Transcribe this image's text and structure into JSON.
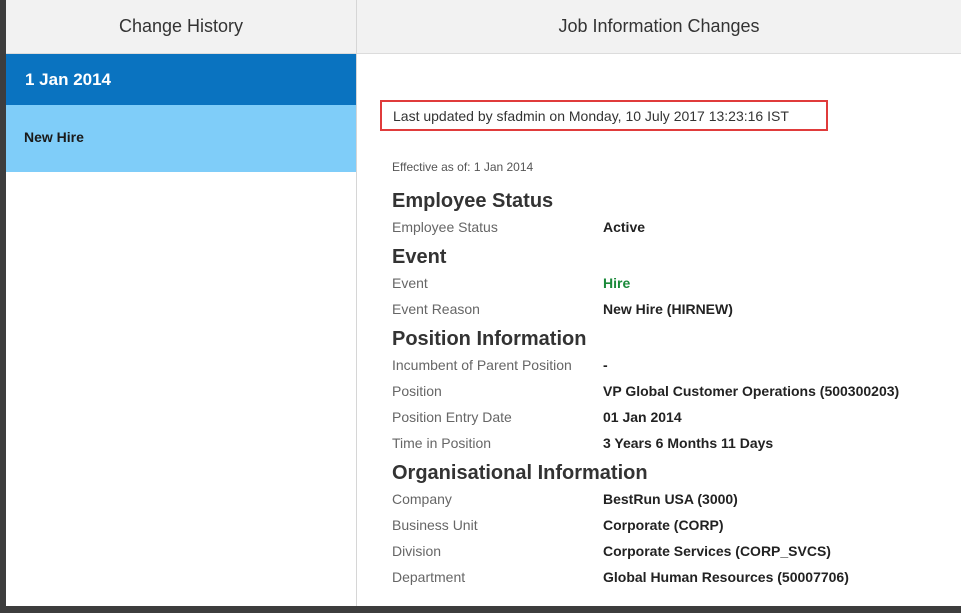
{
  "left_panel": {
    "header": "Change History",
    "date": "1 Jan 2014",
    "item": "New Hire"
  },
  "right_panel": {
    "header": "Job Information Changes",
    "last_updated": "Last updated by sfadmin on Monday, 10 July 2017 13:23:16 IST",
    "effective": "Effective as of: 1 Jan 2014",
    "sections": [
      {
        "title": "Employee Status",
        "rows": [
          {
            "label": "Employee Status",
            "value": "Active"
          }
        ]
      },
      {
        "title": "Event",
        "rows": [
          {
            "label": "Event",
            "value": "Hire"
          },
          {
            "label": "Event Reason",
            "value": "New Hire (HIRNEW)"
          }
        ]
      },
      {
        "title": "Position Information",
        "rows": [
          {
            "label": "Incumbent of Parent Position",
            "value": "-"
          },
          {
            "label": "Position",
            "value": "VP Global Customer Operations (500300203)"
          },
          {
            "label": "Position Entry Date",
            "value": "01 Jan 2014"
          },
          {
            "label": "Time in Position",
            "value": "3 Years 6 Months 11 Days"
          }
        ]
      },
      {
        "title": "Organisational Information",
        "rows": [
          {
            "label": "Company",
            "value": "BestRun USA (3000)"
          },
          {
            "label": "Business Unit",
            "value": "Corporate (CORP)"
          },
          {
            "label": "Division",
            "value": "Corporate Services (CORP_SVCS)"
          },
          {
            "label": "Department",
            "value": "Global Human Resources (50007706)"
          }
        ]
      }
    ]
  },
  "colors": {
    "selected_date_bg": "#0a73c0",
    "history_item_bg": "#7fcdf9",
    "highlight_border": "#e03b3b",
    "event_value": "#1a8a3a"
  }
}
